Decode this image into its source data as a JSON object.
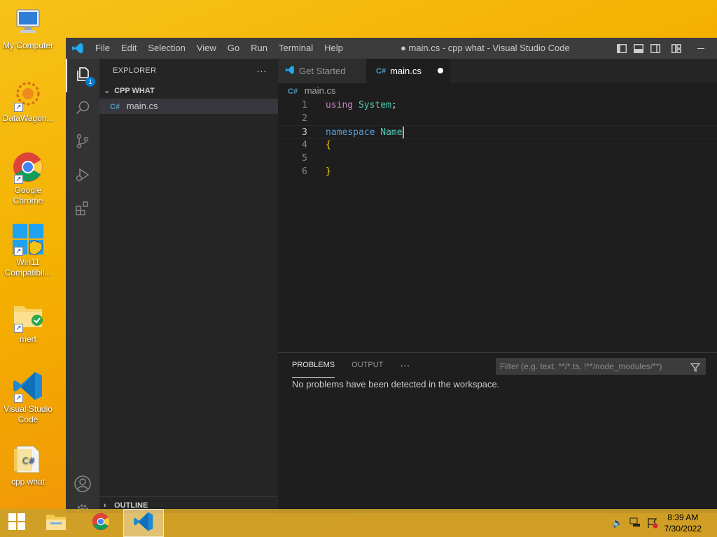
{
  "desktop": {
    "icons": [
      {
        "label": "My Computer"
      },
      {
        "label": "DataWagon..."
      },
      {
        "label": "Google Chrome"
      },
      {
        "label": "Win11 Compatibil..."
      },
      {
        "label": "mert"
      },
      {
        "label": "Visual Studio Code"
      },
      {
        "label": "cpp what"
      }
    ]
  },
  "window": {
    "title": "● main.cs - cpp what - Visual Studio Code",
    "menu": [
      "File",
      "Edit",
      "Selection",
      "View",
      "Go",
      "Run",
      "Terminal",
      "Help"
    ]
  },
  "activity": {
    "explorer_badge": "1",
    "items": [
      "files-icon",
      "search-icon",
      "source-control-icon",
      "run-debug-icon",
      "extensions-icon",
      "account-icon",
      "manage-gear-icon"
    ]
  },
  "sidebar": {
    "title": "EXPLORER",
    "more": "···",
    "folder": "CPP WHAT",
    "file": "main.cs",
    "outline": "OUTLINE"
  },
  "editor": {
    "tabs": [
      {
        "label": "Get Started"
      },
      {
        "label": "main.cs"
      }
    ],
    "breadcrumb": "main.cs",
    "lines": [
      {
        "num": "1",
        "parts": [
          {
            "t": "using",
            "c": "kw2"
          },
          {
            "t": " ",
            "c": "plain"
          },
          {
            "t": "System",
            "c": "ident"
          },
          {
            "t": ";",
            "c": "plain"
          }
        ]
      },
      {
        "num": "2",
        "parts": []
      },
      {
        "num": "3",
        "parts": [
          {
            "t": "namespace",
            "c": "kw"
          },
          {
            "t": " ",
            "c": "plain"
          },
          {
            "t": "Name",
            "c": "ident"
          }
        ]
      },
      {
        "num": "4",
        "parts": [
          {
            "t": "{",
            "c": "brace"
          }
        ]
      },
      {
        "num": "5",
        "parts": []
      },
      {
        "num": "6",
        "parts": [
          {
            "t": "}",
            "c": "brace"
          }
        ]
      }
    ]
  },
  "panel": {
    "tabs": [
      "PROBLEMS",
      "OUTPUT"
    ],
    "more": "···",
    "filter_placeholder": "Filter (e.g. text, **/*.ts, !**/node_modules/**)",
    "message": "No problems have been detected in the workspace."
  },
  "taskbar": {
    "time": "8:39 AM",
    "date": "7/30/2022"
  },
  "colors": {
    "vscode_blue": "#007acc",
    "desktop_orange": "#f4b100"
  }
}
